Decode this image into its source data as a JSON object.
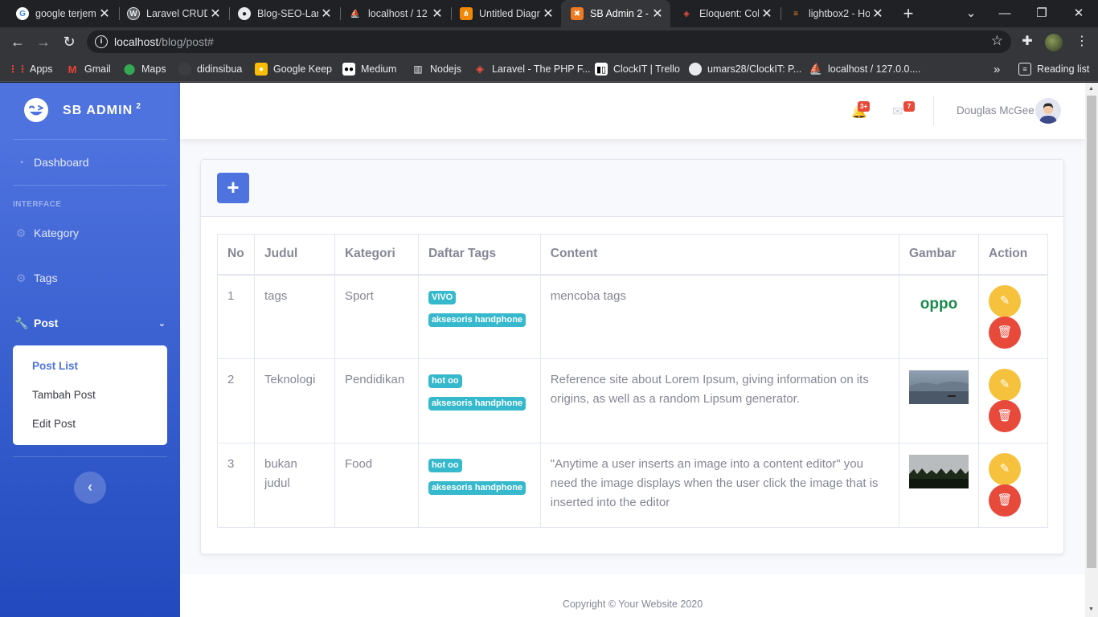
{
  "browser": {
    "tabs": [
      {
        "title": "google terjem",
        "fav_color": "#ffffff",
        "fav_text": "G",
        "fav_text_color": "#4285f4"
      },
      {
        "title": "Laravel CRUD",
        "fav_color": "#5f6368",
        "fav_text": "L",
        "fav_text_color": "#e8eaed"
      },
      {
        "title": "Blog-SEO-Lar",
        "fav_color": "#e8eaed",
        "fav_text": "",
        "fav_text_color": "#202124"
      },
      {
        "title": "localhost / 12",
        "fav_color": "#f29111",
        "fav_text": "",
        "fav_text_color": "#ffffff"
      },
      {
        "title": "Untitled Diagr",
        "fav_color": "#f08705",
        "fav_text": "",
        "fav_text_color": "#ffffff"
      },
      {
        "title": "SB Admin 2 -",
        "fav_color": "#ee7b22",
        "fav_text": "",
        "fav_text_color": "#ffffff"
      },
      {
        "title": "Eloquent: Coll",
        "fav_color": "#f05340",
        "fav_text": "",
        "fav_text_color": "#ffffff"
      },
      {
        "title": "lightbox2 - Ho",
        "fav_color": "#f48024",
        "fav_text": "",
        "fav_text_color": "#ffffff"
      }
    ],
    "active_tab": 5,
    "url_host": "localhost",
    "url_path": "/blog/post#",
    "bookmarks": [
      {
        "label": "Apps",
        "color": "#ea4335"
      },
      {
        "label": "Gmail",
        "color": "#ea4335"
      },
      {
        "label": "Maps",
        "color": "#34a853"
      },
      {
        "label": "didinsibua",
        "color": "#5f6368"
      },
      {
        "label": "Google Keep",
        "color": "#fbbc04"
      },
      {
        "label": "Medium",
        "color": "#ffffff"
      },
      {
        "label": "Nodejs",
        "color": "#e8eaed"
      },
      {
        "label": "Laravel - The PHP F...",
        "color": "#f05340"
      },
      {
        "label": "ClockIT | Trello",
        "color": "#ffffff"
      },
      {
        "label": "umars28/ClockIT: P...",
        "color": "#e8eaed"
      },
      {
        "label": "localhost / 127.0.0....",
        "color": "#f29111"
      }
    ],
    "more_bookmarks": "»",
    "reading_list": "Reading list"
  },
  "sidebar": {
    "brand": "SB ADMIN",
    "brand_sup": "2",
    "dashboard": "Dashboard",
    "heading": "INTERFACE",
    "kategory": "Kategory",
    "tags": "Tags",
    "post": "Post",
    "sub_items": [
      "Post List",
      "Tambah Post",
      "Edit Post"
    ],
    "toggle_icon": "‹"
  },
  "topbar": {
    "alerts_count": "3+",
    "messages_count": "7",
    "user_name": "Douglas McGee"
  },
  "card": {
    "add_icon": "+"
  },
  "table": {
    "headers": [
      "No",
      "Judul",
      "Kategori",
      "Daftar Tags",
      "Content",
      "Gambar",
      "Action"
    ],
    "rows": [
      {
        "no": "1",
        "judul": "tags",
        "kategori": "Sport",
        "tags": [
          "VIVO",
          "aksesoris handphone"
        ],
        "content": "mencoba tags",
        "image": "oppo-logo",
        "image_text": "oppo"
      },
      {
        "no": "2",
        "judul": "Teknologi",
        "kategori": "Pendidikan",
        "tags": [
          "hot oo",
          "aksesoris handphone"
        ],
        "content": "Reference site about Lorem Ipsum, giving information on its origins, as well as a random Lipsum generator.",
        "image": "lake-photo"
      },
      {
        "no": "3",
        "judul": "bukan judul",
        "kategori": "Food",
        "tags": [
          "hot oo",
          "aksesoris handphone"
        ],
        "content": "\"Anytime a user inserts an image into a content editor\" you need the image displays when the user click the image that is inserted into the editor",
        "image": "grass-photo"
      }
    ]
  },
  "footer": {
    "copyright": "Copyright © Your Website 2020"
  },
  "colors": {
    "primary": "#4e73df",
    "info": "#36b9cc",
    "warning": "#f6c23e",
    "danger": "#e74a3b"
  }
}
